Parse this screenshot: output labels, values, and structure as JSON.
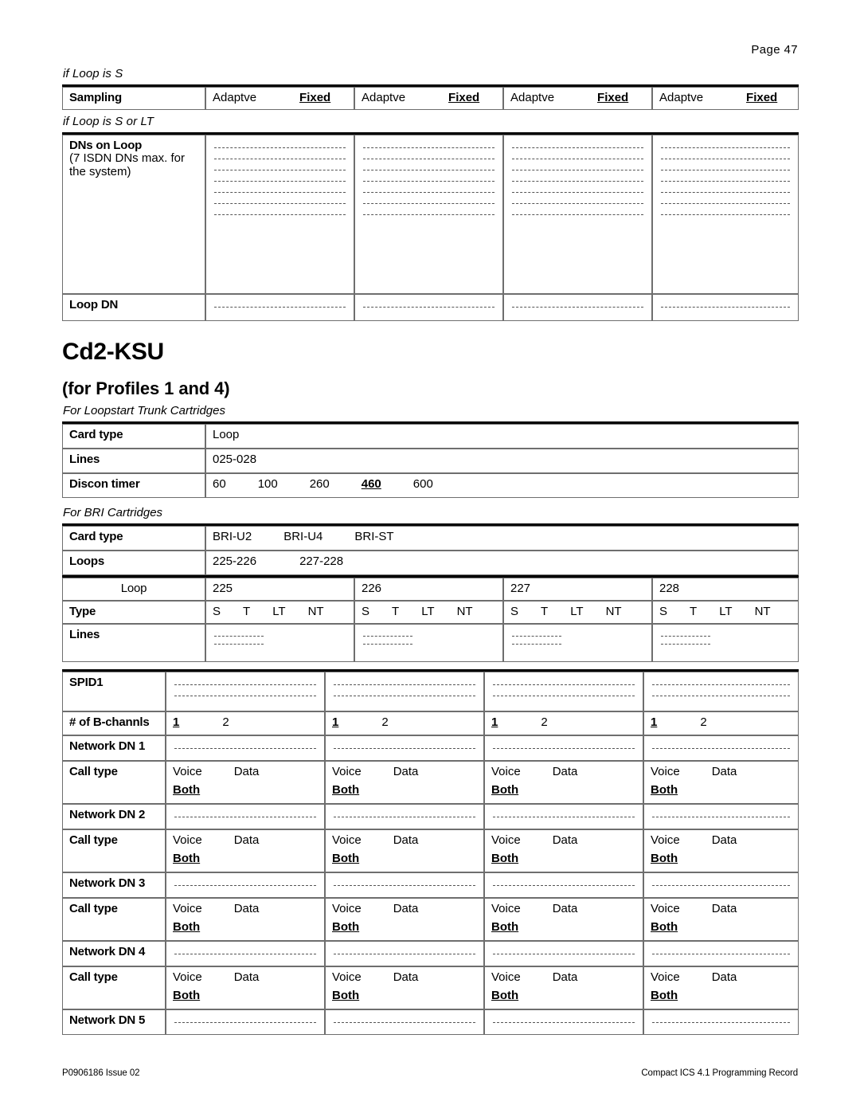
{
  "page": {
    "header": "Page  47",
    "footer_left": "P0906186 Issue 02",
    "footer_right": "Compact ICS 4.1 Programming Record"
  },
  "sampling_section": {
    "condition": "if Loop is S",
    "row_label": "Sampling",
    "columns": [
      {
        "option_a": "Adaptve",
        "option_b": "Fixed"
      },
      {
        "option_a": "Adaptve",
        "option_b": "Fixed"
      },
      {
        "option_a": "Adaptve",
        "option_b": "Fixed"
      },
      {
        "option_a": "Adaptve",
        "option_b": "Fixed"
      }
    ]
  },
  "dns_section": {
    "condition": "if Loop is S or LT",
    "dns_label": "DNs on Loop",
    "dns_sublabel_line1": "(7 ISDN DNs  max. for",
    "dns_sublabel_line2": "the system)",
    "dns_write_lines": 7,
    "loop_dn_label": "Loop DN",
    "loop_dn_write_lines": 1,
    "column_count": 4
  },
  "title": {
    "heading": "Cd2-KSU",
    "subheading": "(for Profiles 1 and 4)"
  },
  "loopstart_section": {
    "note": "For Loopstart Trunk Cartridges",
    "rows": [
      {
        "label": "Card type",
        "value": "Loop"
      },
      {
        "label": "Lines",
        "value": "025-028"
      }
    ],
    "discon": {
      "label": "Discon timer",
      "options": [
        "60",
        "100",
        "260",
        "460",
        "600"
      ],
      "selected": "460"
    }
  },
  "bri_section": {
    "note": "For BRI Cartridges",
    "card_type": {
      "label": "Card type",
      "options": [
        "BRI-U2",
        "BRI-U4",
        "BRI-ST"
      ]
    },
    "loops_row": {
      "label": "Loops",
      "values": [
        "225-226",
        "227-228"
      ]
    },
    "loop_header_label": "Loop",
    "loop_numbers": [
      "225",
      "226",
      "227",
      "228"
    ],
    "type_row": {
      "label": "Type",
      "options": [
        "S",
        "T",
        "LT",
        "NT"
      ]
    },
    "lines_row": {
      "label": "Lines",
      "write_lines": 2
    }
  },
  "spid_section": {
    "column_count": 4,
    "spid1": {
      "label": "SPID1",
      "write_lines": 2
    },
    "b_channels": {
      "label": "# of B-channls",
      "options": [
        "1",
        "2"
      ],
      "selected": "1"
    },
    "call_type": {
      "label": "Call type",
      "options_line1": [
        "Voice",
        "Data"
      ],
      "options_line2": [
        "Both"
      ],
      "selected": "Both"
    },
    "network_dn_labels": [
      "Network DN 1",
      "Network DN 2",
      "Network DN 3",
      "Network DN 4",
      "Network DN 5"
    ]
  }
}
